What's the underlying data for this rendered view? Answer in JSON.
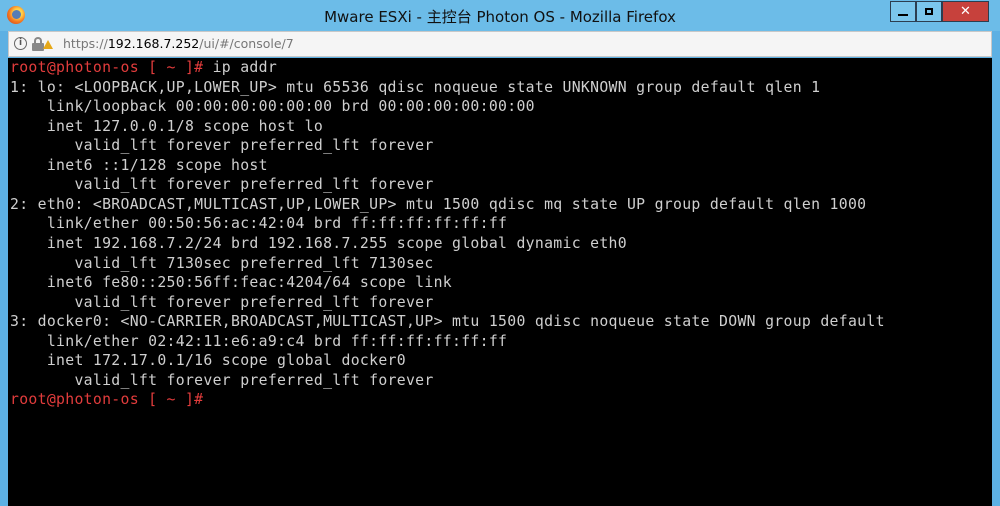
{
  "window": {
    "title": "Mware ESXi - 主控台 Photon OS - Mozilla Firefox",
    "controls": {
      "minimize_icon": "minimize-icon",
      "maximize_icon": "maximize-icon",
      "close_label": "✕"
    }
  },
  "urlbar": {
    "scheme": "https://",
    "host": "192.168.7.252",
    "path": "/ui/#/console/7"
  },
  "terminal": {
    "lines": [
      {
        "type": "prompt",
        "user": "root@photon-os",
        "dir": " [ ~ ]#",
        "cmd": " ip addr"
      },
      {
        "type": "out",
        "text": "1: lo: <LOOPBACK,UP,LOWER_UP> mtu 65536 qdisc noqueue state UNKNOWN group default qlen 1"
      },
      {
        "type": "out",
        "text": "    link/loopback 00:00:00:00:00:00 brd 00:00:00:00:00:00"
      },
      {
        "type": "out",
        "text": "    inet 127.0.0.1/8 scope host lo"
      },
      {
        "type": "out",
        "text": "       valid_lft forever preferred_lft forever"
      },
      {
        "type": "out",
        "text": "    inet6 ::1/128 scope host"
      },
      {
        "type": "out",
        "text": "       valid_lft forever preferred_lft forever"
      },
      {
        "type": "out",
        "text": "2: eth0: <BROADCAST,MULTICAST,UP,LOWER_UP> mtu 1500 qdisc mq state UP group default qlen 1000"
      },
      {
        "type": "out",
        "text": "    link/ether 00:50:56:ac:42:04 brd ff:ff:ff:ff:ff:ff"
      },
      {
        "type": "out",
        "text": "    inet 192.168.7.2/24 brd 192.168.7.255 scope global dynamic eth0"
      },
      {
        "type": "out",
        "text": "       valid_lft 7130sec preferred_lft 7130sec"
      },
      {
        "type": "out",
        "text": "    inet6 fe80::250:56ff:feac:4204/64 scope link"
      },
      {
        "type": "out",
        "text": "       valid_lft forever preferred_lft forever"
      },
      {
        "type": "out",
        "text": "3: docker0: <NO-CARRIER,BROADCAST,MULTICAST,UP> mtu 1500 qdisc noqueue state DOWN group default"
      },
      {
        "type": "out",
        "text": "    link/ether 02:42:11:e6:a9:c4 brd ff:ff:ff:ff:ff:ff"
      },
      {
        "type": "out",
        "text": "    inet 172.17.0.1/16 scope global docker0"
      },
      {
        "type": "out",
        "text": "       valid_lft forever preferred_lft forever"
      },
      {
        "type": "prompt",
        "user": "root@photon-os",
        "dir": " [ ~ ]#",
        "cmd": ""
      }
    ]
  },
  "colors": {
    "terminal_bg": "#000000",
    "terminal_fg": "#cfcfcf",
    "prompt_user": "#e23c3c",
    "titlebar": "#6cbce8",
    "close_button": "#c7413c"
  }
}
